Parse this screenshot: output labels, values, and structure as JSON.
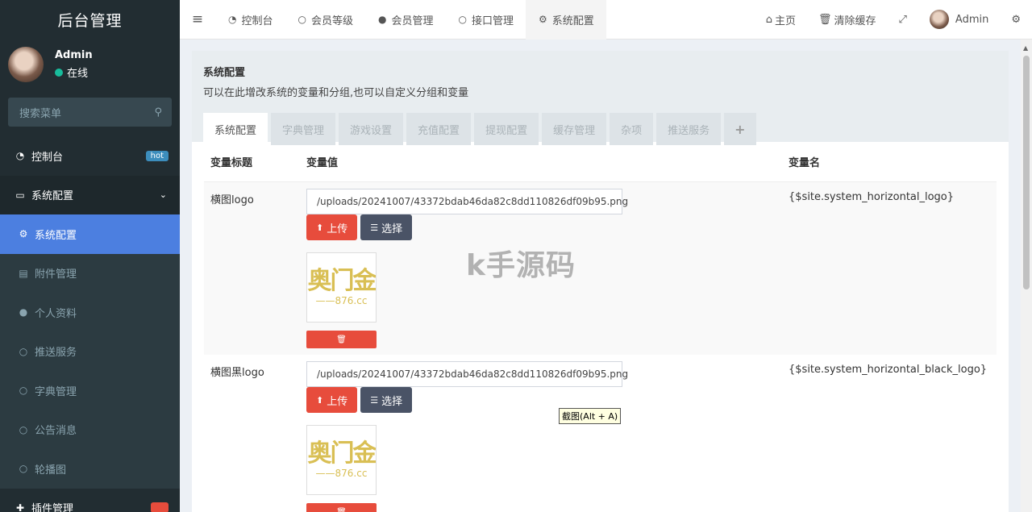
{
  "brand": "后台管理",
  "user": {
    "name": "Admin",
    "status": "在线"
  },
  "search": {
    "placeholder": "搜索菜单"
  },
  "menu": [
    {
      "label": "控制台",
      "icon": "dashboard-icon",
      "badge": "hot"
    },
    {
      "label": "系统配置",
      "icon": "desktop-icon"
    },
    {
      "label": "系统配置",
      "icon": "gear-icon"
    },
    {
      "label": "附件管理",
      "icon": "file-icon"
    },
    {
      "label": "个人资料",
      "icon": "user-icon"
    },
    {
      "label": "推送服务",
      "icon": "circle-icon"
    },
    {
      "label": "字典管理",
      "icon": "circle-icon"
    },
    {
      "label": "公告消息",
      "icon": "circle-icon"
    },
    {
      "label": "轮播图",
      "icon": "circle-icon"
    },
    {
      "label": "插件管理",
      "icon": "plug-icon"
    }
  ],
  "nav_tabs": [
    {
      "label": "控制台",
      "icon": "dashboard-icon"
    },
    {
      "label": "会员等级",
      "icon": "circle-icon"
    },
    {
      "label": "会员管理",
      "icon": "user-icon"
    },
    {
      "label": "接口管理",
      "icon": "circle-icon"
    },
    {
      "label": "系统配置",
      "icon": "gear-icon"
    }
  ],
  "header_right": {
    "home": "主页",
    "clear_cache": "清除缓存",
    "admin": "Admin"
  },
  "panel": {
    "title": "系统配置",
    "desc": "可以在此增改系统的变量和分组,也可以自定义分组和变量",
    "tabs": [
      "系统配置",
      "字典管理",
      "游戏设置",
      "充值配置",
      "提现配置",
      "缓存管理",
      "杂项",
      "推送服务"
    ]
  },
  "table": {
    "headers": [
      "变量标题",
      "变量值",
      "变量名"
    ],
    "rows": [
      {
        "title": "横图logo",
        "value": "/uploads/20241007/43372bdab46da82c8dd110826df09b95.png",
        "var": "{$site.system_horizontal_logo}"
      },
      {
        "title": "横图黑logo",
        "value": "/uploads/20241007/43372bdab46da82c8dd110826df09b95.png",
        "var": "{$site.system_horizontal_black_logo}"
      }
    ],
    "upload_label": "上传",
    "choose_label": "选择"
  },
  "thumb_text": {
    "line1": "奥门金",
    "line2": "——876.cc"
  },
  "watermark": "k手源码",
  "tooltip": "截图(Alt + A)"
}
